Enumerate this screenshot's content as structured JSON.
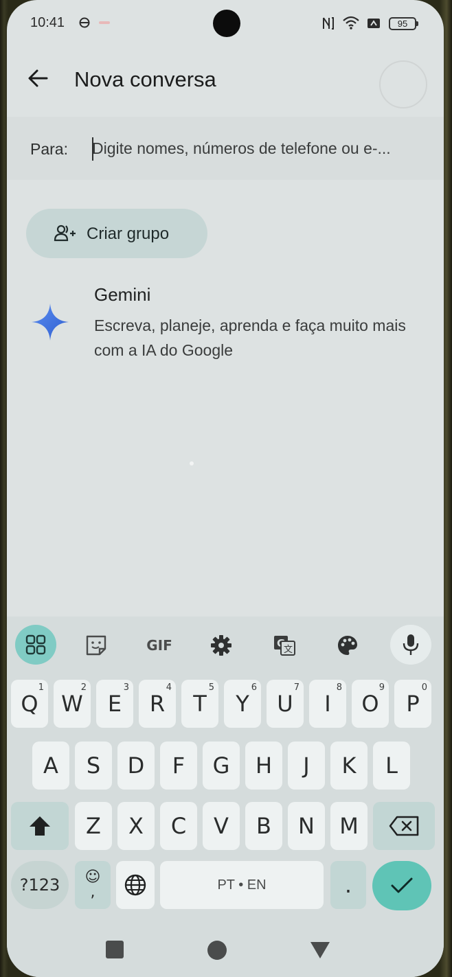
{
  "status_bar": {
    "time": "10:41",
    "battery": "95"
  },
  "app_bar": {
    "title": "Nova conversa"
  },
  "recipient": {
    "label": "Para:",
    "placeholder": "Digite nomes, números de telefone ou e-..."
  },
  "chip": {
    "label": "Criar grupo"
  },
  "gemini": {
    "name": "Gemini",
    "description": "Escreva, planeje, aprenda e faça muito mais com a IA do Google"
  },
  "keyboard": {
    "toolbar": [
      "apps-icon",
      "sticker-icon",
      "GIF",
      "settings-icon",
      "translate-icon",
      "palette-icon",
      "mic-icon"
    ],
    "gif_label": "GIF",
    "row1": [
      {
        "key": "Q",
        "hint": "1"
      },
      {
        "key": "W",
        "hint": "2"
      },
      {
        "key": "E",
        "hint": "3"
      },
      {
        "key": "R",
        "hint": "4"
      },
      {
        "key": "T",
        "hint": "5"
      },
      {
        "key": "Y",
        "hint": "6"
      },
      {
        "key": "U",
        "hint": "7"
      },
      {
        "key": "I",
        "hint": "8"
      },
      {
        "key": "O",
        "hint": "9"
      },
      {
        "key": "P",
        "hint": "0"
      }
    ],
    "row2": [
      "A",
      "S",
      "D",
      "F",
      "G",
      "H",
      "J",
      "K",
      "L"
    ],
    "row3": [
      "Z",
      "X",
      "C",
      "V",
      "B",
      "N",
      "M"
    ],
    "symbols_label": "?123",
    "emoji_top": "☺",
    "emoji_bottom": ",",
    "space_label": "PT • EN",
    "period_label": ".",
    "accent": "#5fc4b6"
  }
}
